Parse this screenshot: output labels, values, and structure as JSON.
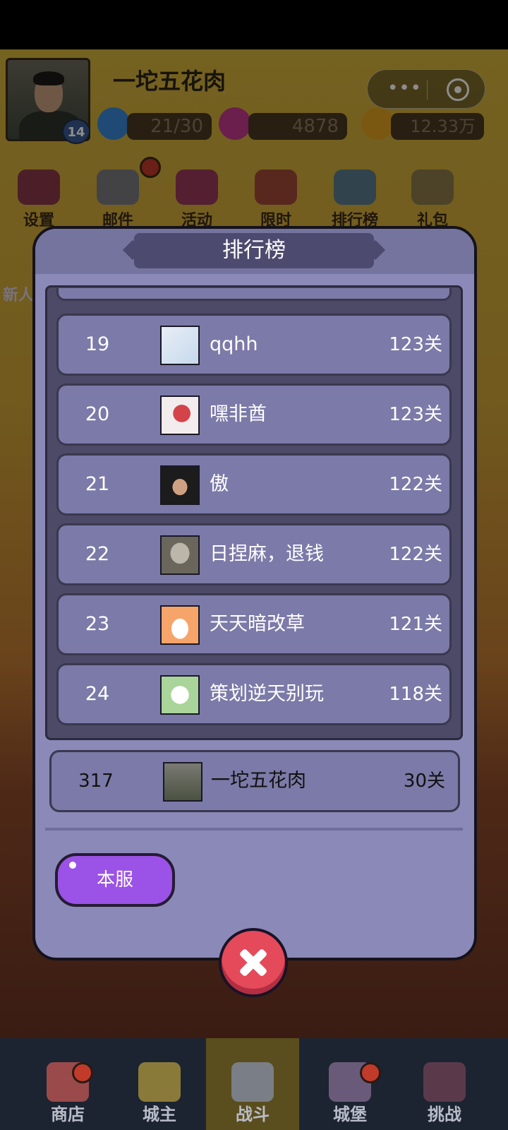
{
  "header": {
    "player_name": "一坨五花肉",
    "level": "14",
    "energy": "21/30",
    "gems": "4878",
    "gold": "12.33万"
  },
  "top_menu": [
    {
      "label": "设置"
    },
    {
      "label": "邮件"
    },
    {
      "label": "活动"
    },
    {
      "label": "限时"
    },
    {
      "label": "排行榜"
    },
    {
      "label": "礼包"
    }
  ],
  "side_label": "新人",
  "leaderboard": {
    "title": "排行榜",
    "rows": [
      {
        "rank": "19",
        "name": "qqhh",
        "level": "123关"
      },
      {
        "rank": "20",
        "name": "嘿非酋",
        "level": "123关"
      },
      {
        "rank": "21",
        "name": "傲",
        "level": "122关"
      },
      {
        "rank": "22",
        "name": "日捏麻，退钱",
        "level": "122关"
      },
      {
        "rank": "23",
        "name": "天天暗改草",
        "level": "121关"
      },
      {
        "rank": "24",
        "name": "策划逆天别玩",
        "level": "118关"
      }
    ],
    "my_row": {
      "rank": "317",
      "name": "一坨五花肉",
      "level": "30关"
    },
    "server_button": "本服"
  },
  "bottom_nav": [
    {
      "label": "商店"
    },
    {
      "label": "城主"
    },
    {
      "label": "战斗"
    },
    {
      "label": "城堡"
    },
    {
      "label": "挑战"
    }
  ],
  "colors": {
    "panel": "#8a89b7",
    "row": "#7b7aa8",
    "server_button": "#9b52e6",
    "close_button": "#e54a5a"
  }
}
